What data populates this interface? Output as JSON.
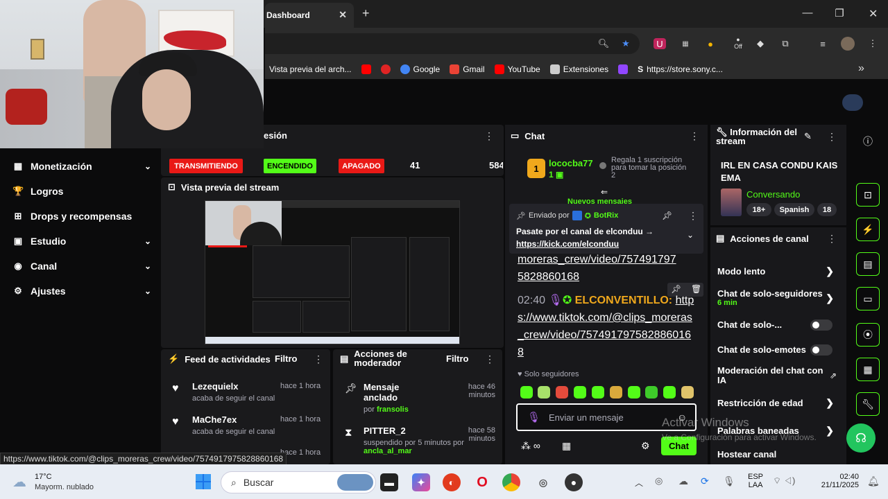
{
  "browser": {
    "tab_title": "Dashboard",
    "tab_close": "✕",
    "new_tab": "+",
    "bookmarks": [
      {
        "label": "Vista previa del arch...",
        "color": "#2b2b2b"
      },
      {
        "label": "",
        "color": "#ff0000"
      },
      {
        "label": "",
        "color": "#e02424"
      },
      {
        "label": "Google",
        "color": "#4285f4"
      },
      {
        "label": "Gmail",
        "color": "#ea4335"
      },
      {
        "label": "YouTube",
        "color": "#ff0000"
      },
      {
        "label": "Extensiones",
        "color": "#cccccc"
      },
      {
        "label": "",
        "color": "#9146ff"
      },
      {
        "label": "https://store.sony.c...",
        "color": "#dddddd"
      }
    ],
    "ext_off_label": "Off",
    "more_bookmarks": "»"
  },
  "nav": {
    "items": [
      {
        "label": "Monetización",
        "icon": "▦",
        "chev": "⌄"
      },
      {
        "label": "Logros",
        "icon": "🏆",
        "chev": ""
      },
      {
        "label": "Drops y recompensas",
        "icon": "⊞",
        "chev": ""
      },
      {
        "label": "Estudio",
        "icon": "▣",
        "chev": "⌄"
      },
      {
        "label": "Canal",
        "icon": "◉",
        "chev": "⌄"
      },
      {
        "label": "Ajustes",
        "icon": "⚙",
        "chev": "⌄"
      }
    ]
  },
  "session": {
    "title": "esión",
    "badges": [
      {
        "label": "TRANSMITIENDO",
        "color": "#e91916"
      },
      {
        "label": "ENCENDIDO",
        "color": "#53fc18"
      },
      {
        "label": "APAGADO",
        "color": "#e91916"
      }
    ],
    "value1": "41",
    "value2": "584"
  },
  "preview": {
    "title": "Vista previa del stream"
  },
  "feed": {
    "title": "Feed de actividades",
    "filter": "Filtro",
    "items": [
      {
        "name": "Lezequielx",
        "sub": "acaba de seguir el canal",
        "time": "hace 1 hora"
      },
      {
        "name": "MaChe7ex",
        "sub": "acaba de seguir el canal",
        "time": "hace 1 hora"
      },
      {
        "name": "",
        "sub": "",
        "time": "hace 1 hora"
      }
    ]
  },
  "mod": {
    "title": "Acciones de moderador",
    "filter": "Filtro",
    "items": [
      {
        "action": "Mensaje anclado",
        "by_prefix": "por",
        "by": "fransolis",
        "time": "hace 46 minutos"
      },
      {
        "action": "PITTER_2",
        "by_prefix": "suspendido por 5 minutos por",
        "by": "ancla_al_mar",
        "time": "hace 58 minutos"
      }
    ]
  },
  "chat": {
    "title": "Chat",
    "top_gifter": {
      "name": "lococba77",
      "count": "1",
      "rank": "1",
      "note": "Regala 1 suscripción para tomar la posición 2"
    },
    "new_messages": "Nuevos mensajes",
    "pinned": {
      "sent_by_label": "Enviado por",
      "sender": "BotRix",
      "text": "Pasate por el canal de elconduu →",
      "link": "https://kick.com/elconduu"
    },
    "msg1_tail": "moreras_crew/video/757491797 5828860168",
    "msg2": {
      "time": "02:40",
      "user": "ELCONVENTILLO:",
      "link": "https://www.tiktok.com/@clips_moreras_crew/video/7574917975828860168"
    },
    "followers_only": "Solo seguidores",
    "input_placeholder": "Enviar un mensaje",
    "send_button": "Chat"
  },
  "stream_info": {
    "title": "Información del stream",
    "stream_title": "IRL EN CASA CONDU KAIS EMA",
    "category": "Conversando",
    "tags": [
      "18+",
      "Spanish",
      "18"
    ]
  },
  "channel_actions": {
    "title": "Acciones de canal",
    "rows": [
      {
        "label": "Modo lento",
        "sub": "",
        "kind": "arrow"
      },
      {
        "label": "Chat de solo-seguidores",
        "sub": "6 min",
        "kind": "arrow"
      },
      {
        "label": "Chat de solo-...",
        "sub": "",
        "kind": "toggle"
      },
      {
        "label": "Chat de solo-emotes",
        "sub": "",
        "kind": "toggle"
      },
      {
        "label": "Moderación del chat con IA",
        "sub": "",
        "kind": "external"
      },
      {
        "label": "Restricción de edad",
        "sub": "",
        "kind": "arrow"
      },
      {
        "label": "Palabras baneadas",
        "sub": "",
        "kind": "arrow"
      },
      {
        "label": "Hostear canal",
        "sub": "",
        "kind": "none"
      }
    ]
  },
  "status_url": "https://www.tiktok.com/@clips_moreras_crew/video/7574917975828860168",
  "watermark": {
    "title": "Activar Windows",
    "sub": "Ve a Configuración para activar Windows."
  },
  "taskbar": {
    "weather_temp": "17°C",
    "weather_desc": "Mayorm. nublado",
    "search_placeholder": "Buscar",
    "lang1": "ESP",
    "lang2": "LAA",
    "time": "02:40",
    "date": "21/11/2025"
  }
}
